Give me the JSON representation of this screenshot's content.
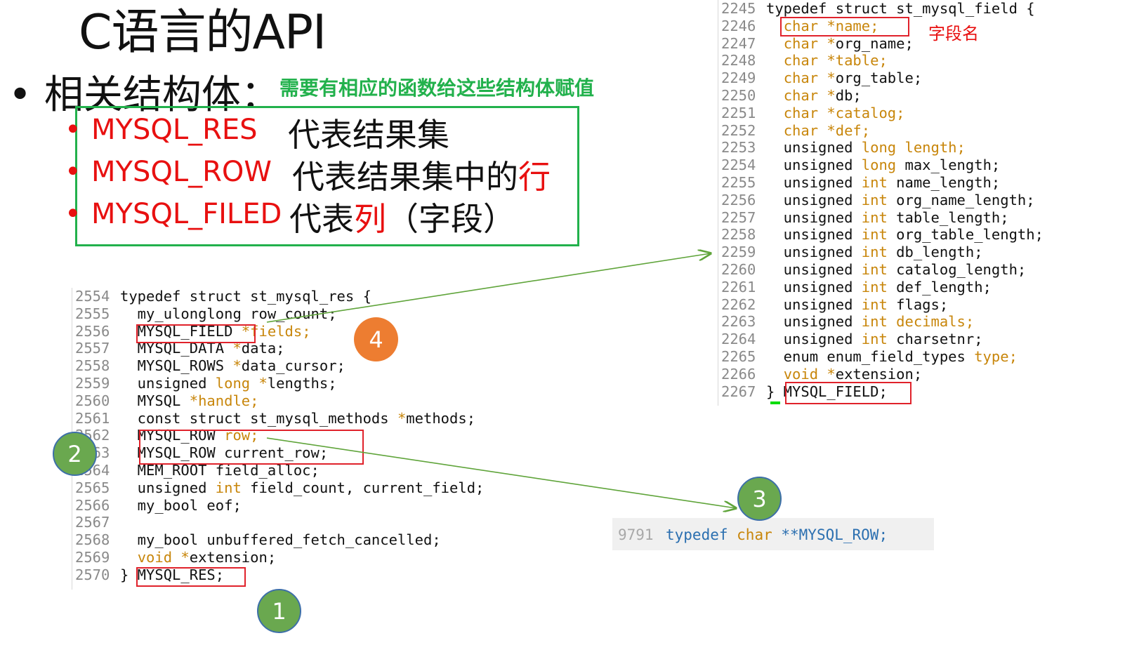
{
  "slide": {
    "title": "C语言的API",
    "bullet": "• 相关结构体：",
    "note": "需要有相应的函数给这些结构体赋值",
    "items": [
      {
        "dot": "•",
        "name": "MYSQL_RES",
        "desc_a": "代表结果集",
        "desc_red": "",
        "desc_b": ""
      },
      {
        "dot": "•",
        "name": "MYSQL_ROW",
        "desc_a": "代表结果集中的",
        "desc_red": "行",
        "desc_b": ""
      },
      {
        "dot": "•",
        "name": "MYSQL_FILED",
        "desc_a": "代表",
        "desc_red": "列",
        "desc_b": "（字段）"
      }
    ]
  },
  "code_left": {
    "lines": [
      {
        "n": "2554",
        "t": [
          [
            "typedef struct st_mysql_res {",
            ""
          ]
        ]
      },
      {
        "n": "2555",
        "t": [
          [
            "  my_ulonglong row_count;",
            ""
          ]
        ]
      },
      {
        "n": "2556",
        "t": [
          [
            "  MYSQL_FIELD ",
            ""
          ],
          [
            "*fields;",
            "kw"
          ]
        ]
      },
      {
        "n": "2557",
        "t": [
          [
            "  MYSQL_DATA ",
            ""
          ],
          [
            "*",
            "kw"
          ],
          [
            "data;",
            ""
          ]
        ]
      },
      {
        "n": "2558",
        "t": [
          [
            "  MYSQL_ROWS ",
            ""
          ],
          [
            "*",
            "kw"
          ],
          [
            "data_cursor;",
            ""
          ]
        ]
      },
      {
        "n": "2559",
        "t": [
          [
            "  unsigned ",
            ""
          ],
          [
            "long ",
            "kw"
          ],
          [
            "*",
            "kw"
          ],
          [
            "lengths;",
            ""
          ]
        ]
      },
      {
        "n": "2560",
        "t": [
          [
            "  MYSQL ",
            ""
          ],
          [
            "*handle;",
            "kw"
          ]
        ]
      },
      {
        "n": "2561",
        "t": [
          [
            "  const struct st_mysql_methods ",
            ""
          ],
          [
            "*",
            "kw"
          ],
          [
            "methods;",
            ""
          ]
        ]
      },
      {
        "n": "2562",
        "t": [
          [
            "  MYSQL_ROW ",
            ""
          ],
          [
            "row;",
            "kw"
          ]
        ]
      },
      {
        "n": "2563",
        "t": [
          [
            "  MYSQL_ROW current_row;",
            ""
          ]
        ]
      },
      {
        "n": "2564",
        "t": [
          [
            "  MEM_ROOT field_alloc;",
            ""
          ]
        ]
      },
      {
        "n": "2565",
        "t": [
          [
            "  unsigned ",
            ""
          ],
          [
            "int ",
            "kw"
          ],
          [
            "field_count, current_field;",
            ""
          ]
        ]
      },
      {
        "n": "2566",
        "t": [
          [
            "  my_bool eof;",
            ""
          ]
        ]
      },
      {
        "n": "2567",
        "t": [
          [
            "",
            ""
          ]
        ]
      },
      {
        "n": "2568",
        "t": [
          [
            "  my_bool unbuffered_fetch_cancelled;",
            ""
          ]
        ]
      },
      {
        "n": "2569",
        "t": [
          [
            "  ",
            ""
          ],
          [
            "void ",
            "kw"
          ],
          [
            "*",
            "kw"
          ],
          [
            "extension;",
            ""
          ]
        ]
      },
      {
        "n": "2570",
        "t": [
          [
            "} MYSQL_RES;",
            ""
          ]
        ]
      }
    ]
  },
  "code_right": {
    "lines": [
      {
        "n": "2245",
        "t": [
          [
            "typedef struct st_mysql_field {",
            ""
          ]
        ]
      },
      {
        "n": "2246",
        "t": [
          [
            "  ",
            ""
          ],
          [
            "char ",
            "kw"
          ],
          [
            "*name;",
            "kw"
          ]
        ]
      },
      {
        "n": "2247",
        "t": [
          [
            "  ",
            ""
          ],
          [
            "char ",
            "kw"
          ],
          [
            "*",
            "kw"
          ],
          [
            "org_name;",
            ""
          ]
        ]
      },
      {
        "n": "2248",
        "t": [
          [
            "  ",
            ""
          ],
          [
            "char ",
            "kw"
          ],
          [
            "*table;",
            "kw"
          ]
        ]
      },
      {
        "n": "2249",
        "t": [
          [
            "  ",
            ""
          ],
          [
            "char ",
            "kw"
          ],
          [
            "*",
            "kw"
          ],
          [
            "org_table;",
            ""
          ]
        ]
      },
      {
        "n": "2250",
        "t": [
          [
            "  ",
            ""
          ],
          [
            "char ",
            "kw"
          ],
          [
            "*",
            "kw"
          ],
          [
            "db;",
            ""
          ]
        ]
      },
      {
        "n": "2251",
        "t": [
          [
            "  ",
            ""
          ],
          [
            "char ",
            "kw"
          ],
          [
            "*catalog;",
            "kw"
          ]
        ]
      },
      {
        "n": "2252",
        "t": [
          [
            "  ",
            ""
          ],
          [
            "char ",
            "kw"
          ],
          [
            "*def;",
            "kw"
          ]
        ]
      },
      {
        "n": "2253",
        "t": [
          [
            "  unsigned ",
            ""
          ],
          [
            "long length;",
            "kw"
          ]
        ]
      },
      {
        "n": "2254",
        "t": [
          [
            "  unsigned ",
            ""
          ],
          [
            "long ",
            "kw"
          ],
          [
            "max_length;",
            ""
          ]
        ]
      },
      {
        "n": "2255",
        "t": [
          [
            "  unsigned ",
            ""
          ],
          [
            "int ",
            "kw"
          ],
          [
            "name_length;",
            ""
          ]
        ]
      },
      {
        "n": "2256",
        "t": [
          [
            "  unsigned ",
            ""
          ],
          [
            "int ",
            "kw"
          ],
          [
            "org_name_length;",
            ""
          ]
        ]
      },
      {
        "n": "2257",
        "t": [
          [
            "  unsigned ",
            ""
          ],
          [
            "int ",
            "kw"
          ],
          [
            "table_length;",
            ""
          ]
        ]
      },
      {
        "n": "2258",
        "t": [
          [
            "  unsigned ",
            ""
          ],
          [
            "int ",
            "kw"
          ],
          [
            "org_table_length;",
            ""
          ]
        ]
      },
      {
        "n": "2259",
        "t": [
          [
            "  unsigned ",
            ""
          ],
          [
            "int ",
            "kw"
          ],
          [
            "db_length;",
            ""
          ]
        ]
      },
      {
        "n": "2260",
        "t": [
          [
            "  unsigned ",
            ""
          ],
          [
            "int ",
            "kw"
          ],
          [
            "catalog_length;",
            ""
          ]
        ]
      },
      {
        "n": "2261",
        "t": [
          [
            "  unsigned ",
            ""
          ],
          [
            "int ",
            "kw"
          ],
          [
            "def_length;",
            ""
          ]
        ]
      },
      {
        "n": "2262",
        "t": [
          [
            "  unsigned ",
            ""
          ],
          [
            "int ",
            "kw"
          ],
          [
            "flags;",
            ""
          ]
        ]
      },
      {
        "n": "2263",
        "t": [
          [
            "  unsigned ",
            ""
          ],
          [
            "int decimals;",
            "kw"
          ]
        ]
      },
      {
        "n": "2264",
        "t": [
          [
            "  unsigned ",
            ""
          ],
          [
            "int ",
            "kw"
          ],
          [
            "charsetnr;",
            ""
          ]
        ]
      },
      {
        "n": "2265",
        "t": [
          [
            "  enum enum_field_types ",
            ""
          ],
          [
            "type;",
            "kw"
          ]
        ]
      },
      {
        "n": "2266",
        "t": [
          [
            "  ",
            ""
          ],
          [
            "void ",
            "kw"
          ],
          [
            "*",
            "kw"
          ],
          [
            "extension;",
            ""
          ]
        ]
      },
      {
        "n": "2267",
        "t": [
          [
            "} MYSQL_FIELD;",
            ""
          ]
        ]
      }
    ]
  },
  "annotation_right": "字段名",
  "typedef_row": {
    "n": "9791",
    "t": [
      [
        "typedef ",
        "ty"
      ],
      [
        "char ",
        "kw"
      ],
      [
        "**MYSQL_ROW;",
        "ty"
      ]
    ]
  },
  "badges": [
    {
      "label": "1",
      "color": "#6aa84f"
    },
    {
      "label": "2",
      "color": "#6aa84f"
    },
    {
      "label": "3",
      "color": "#6aa84f"
    },
    {
      "label": "4",
      "color": "#ed7d31"
    }
  ],
  "colors": {
    "accent_green": "#22b14c",
    "highlight_red": "#e81010",
    "keyword": "#c8860b",
    "type_blue": "#2b6fb0"
  }
}
